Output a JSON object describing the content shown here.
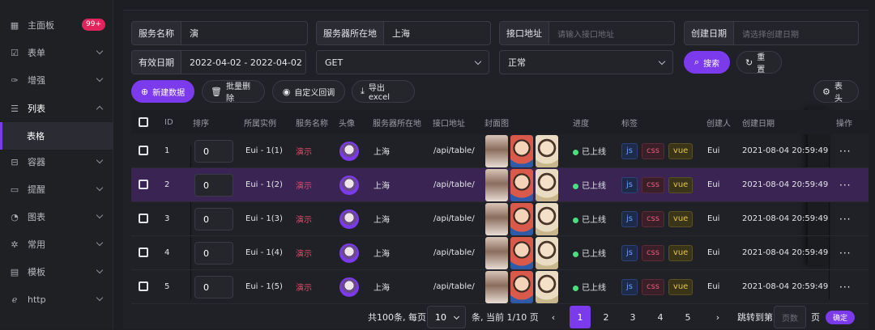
{
  "sidebar": {
    "items": [
      {
        "label": "主面板",
        "icon": "dashboard-icon",
        "badge": "99+"
      },
      {
        "label": "表单",
        "icon": "form-icon"
      },
      {
        "label": "增强",
        "icon": "magic-icon"
      },
      {
        "label": "列表",
        "icon": "list-icon",
        "expanded": true
      },
      {
        "label": "容器",
        "icon": "container-icon"
      },
      {
        "label": "提醒",
        "icon": "message-icon"
      },
      {
        "label": "图表",
        "icon": "chart-icon"
      },
      {
        "label": "常用",
        "icon": "gear-icon"
      },
      {
        "label": "模板",
        "icon": "template-icon"
      },
      {
        "label": "http",
        "icon": "ie-icon"
      }
    ],
    "sub_active": "表格"
  },
  "filters": {
    "service_name": {
      "label": "服务名称",
      "value": "演"
    },
    "server_location": {
      "label": "服务器所在地",
      "value": "上海"
    },
    "api_url": {
      "label": "接口地址",
      "placeholder": "请输入接口地址"
    },
    "create_date": {
      "label": "创建日期",
      "placeholder": "请选择创建日期"
    },
    "valid_date": {
      "label": "有效日期",
      "value": "2022-04-02 - 2022-04-02"
    },
    "method": {
      "value": "GET"
    },
    "status": {
      "value": "正常"
    },
    "search": "搜索",
    "reset": "重置"
  },
  "toolbar": {
    "add": "新建数据",
    "batch_delete": "批量删除",
    "custom_callback": "自定义回调",
    "export": "导出excel",
    "header": "表头"
  },
  "table": {
    "headers": [
      "ID",
      "排序",
      "所属实例",
      "服务名称",
      "头像",
      "服务器所在地",
      "接口地址",
      "封面图",
      "进度",
      "标签",
      "创建人",
      "创建日期",
      "操作"
    ],
    "rows": [
      {
        "id": "1",
        "sort": "0",
        "instance": "Eui - 1(1)",
        "service": "演示",
        "location": "上海",
        "api": "/api/table/",
        "progress": "已上线",
        "tags": [
          "js",
          "css",
          "vue"
        ],
        "creator": "Eui",
        "date": "2021-08-04 20:59:49"
      },
      {
        "id": "2",
        "sort": "0",
        "instance": "Eui - 1(2)",
        "service": "演示",
        "location": "上海",
        "api": "/api/table/",
        "progress": "已上线",
        "tags": [
          "js",
          "css",
          "vue"
        ],
        "creator": "Eui",
        "date": "2021-08-04 20:59:49"
      },
      {
        "id": "3",
        "sort": "0",
        "instance": "Eui - 1(3)",
        "service": "演示",
        "location": "上海",
        "api": "/api/table/",
        "progress": "已上线",
        "tags": [
          "js",
          "css",
          "vue"
        ],
        "creator": "Eui",
        "date": "2021-08-04 20:59:49"
      },
      {
        "id": "4",
        "sort": "0",
        "instance": "Eui - 1(4)",
        "service": "演示",
        "location": "上海",
        "api": "/api/table/",
        "progress": "已上线",
        "tags": [
          "js",
          "css",
          "vue"
        ],
        "creator": "Eui",
        "date": "2021-08-04 20:59:49"
      },
      {
        "id": "5",
        "sort": "0",
        "instance": "Eui - 1(5)",
        "service": "演示",
        "location": "上海",
        "api": "/api/table/",
        "progress": "已上线",
        "tags": [
          "js",
          "css",
          "vue"
        ],
        "creator": "Eui",
        "date": "2021-08-04 20:59:49"
      }
    ],
    "more": "···"
  },
  "pagination": {
    "total_text": "共100条, 每页",
    "page_size": "10",
    "page_info": "条, 当前 1/10 页",
    "pages": [
      "1",
      "2",
      "3",
      "4",
      "5"
    ],
    "prev": "‹",
    "next": "›",
    "jump_label": "跳转到第",
    "jump_placeholder": "页数",
    "page_unit": "页",
    "confirm": "确定"
  },
  "colors": {
    "accent": "#7c3aed",
    "danger": "#e14a6a",
    "success": "#4ade80"
  }
}
